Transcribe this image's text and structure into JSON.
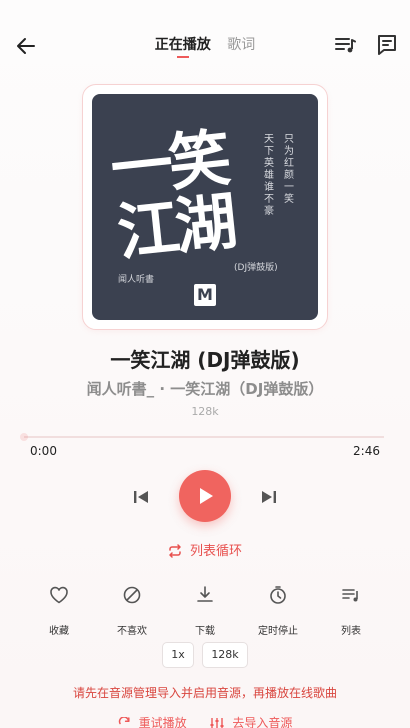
{
  "header": {
    "tabs": [
      {
        "label": "正在播放",
        "active": true
      },
      {
        "label": "歌词",
        "active": false
      }
    ],
    "icons": [
      "back-arrow-icon",
      "playlist-icon",
      "comment-icon"
    ]
  },
  "cover": {
    "art_title": "一笑江湖",
    "art_vertical_left": "天下英雄谁不豪",
    "art_vertical_right": "只为红颜一笑",
    "art_subtitle": "(DJ弹鼓版)",
    "art_artist": "闻人听書",
    "art_logo": "M"
  },
  "song": {
    "title": "一笑江湖 (DJ弹鼓版)",
    "artist_album": "闻人听書_ · 一笑江湖（DJ弹鼓版）",
    "quality": "128k"
  },
  "progress": {
    "current": "0:00",
    "total": "2:46",
    "fraction": 0.0
  },
  "controls": {
    "play_mode": "列表循环"
  },
  "actions": [
    {
      "label": "收藏",
      "icon": "heart-icon"
    },
    {
      "label": "不喜欢",
      "icon": "block-icon"
    },
    {
      "label": "下载",
      "icon": "download-icon"
    },
    {
      "label": "定时停止",
      "icon": "timer-icon"
    },
    {
      "label": "列表",
      "icon": "list-icon"
    }
  ],
  "chips": {
    "speed": "1x",
    "quality": "128k"
  },
  "notice": "请先在音源管理导入并启用音源，再播放在线歌曲",
  "bottom": {
    "retry": "重试播放",
    "import": "去导入音源"
  },
  "colors": {
    "accent": "#ee5a5a",
    "play_button": "#f0645f",
    "cover_bg": "#3b4150"
  }
}
